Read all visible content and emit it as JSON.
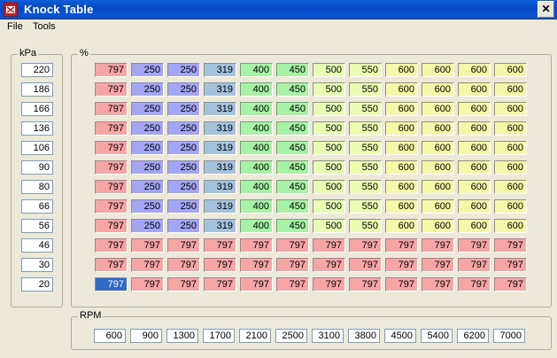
{
  "window": {
    "title": "Knock Table",
    "close_label": "✕"
  },
  "menu": [
    "File",
    "Tools"
  ],
  "kpa": {
    "label": "kPa",
    "values": [
      "220",
      "186",
      "166",
      "136",
      "106",
      "90",
      "80",
      "66",
      "56",
      "46",
      "30",
      "20"
    ]
  },
  "table": {
    "label": "%",
    "rows": [
      [
        "797",
        "250",
        "250",
        "319",
        "400",
        "450",
        "500",
        "550",
        "600",
        "600",
        "600",
        "600"
      ],
      [
        "797",
        "250",
        "250",
        "319",
        "400",
        "450",
        "500",
        "550",
        "600",
        "600",
        "600",
        "600"
      ],
      [
        "797",
        "250",
        "250",
        "319",
        "400",
        "450",
        "500",
        "550",
        "600",
        "600",
        "600",
        "600"
      ],
      [
        "797",
        "250",
        "250",
        "319",
        "400",
        "450",
        "500",
        "550",
        "600",
        "600",
        "600",
        "600"
      ],
      [
        "797",
        "250",
        "250",
        "319",
        "400",
        "450",
        "500",
        "550",
        "600",
        "600",
        "600",
        "600"
      ],
      [
        "797",
        "250",
        "250",
        "319",
        "400",
        "450",
        "500",
        "550",
        "600",
        "600",
        "600",
        "600"
      ],
      [
        "797",
        "250",
        "250",
        "319",
        "400",
        "450",
        "500",
        "550",
        "600",
        "600",
        "600",
        "600"
      ],
      [
        "797",
        "250",
        "250",
        "319",
        "400",
        "450",
        "500",
        "550",
        "600",
        "600",
        "600",
        "600"
      ],
      [
        "797",
        "250",
        "250",
        "319",
        "400",
        "450",
        "500",
        "550",
        "600",
        "600",
        "600",
        "600"
      ],
      [
        "797",
        "797",
        "797",
        "797",
        "797",
        "797",
        "797",
        "797",
        "797",
        "797",
        "797",
        "797"
      ],
      [
        "797",
        "797",
        "797",
        "797",
        "797",
        "797",
        "797",
        "797",
        "797",
        "797",
        "797",
        "797"
      ],
      [
        "797",
        "797",
        "797",
        "797",
        "797",
        "797",
        "797",
        "797",
        "797",
        "797",
        "797",
        "797"
      ]
    ],
    "selected": {
      "row": 11,
      "col": 0
    },
    "value_colors": {
      "250": "#a5a5f5",
      "319": "#a4c2dc",
      "400": "#a6f2a6",
      "450": "#a6f2a6",
      "500": "#e8fcb4",
      "550": "#ecfcb0",
      "600": "#f4f8a8",
      "797": "#f6a5a5"
    }
  },
  "rpm": {
    "label": "RPM",
    "values": [
      "600",
      "900",
      "1300",
      "1700",
      "2100",
      "2500",
      "3100",
      "3800",
      "4500",
      "5400",
      "6200",
      "7000"
    ]
  }
}
